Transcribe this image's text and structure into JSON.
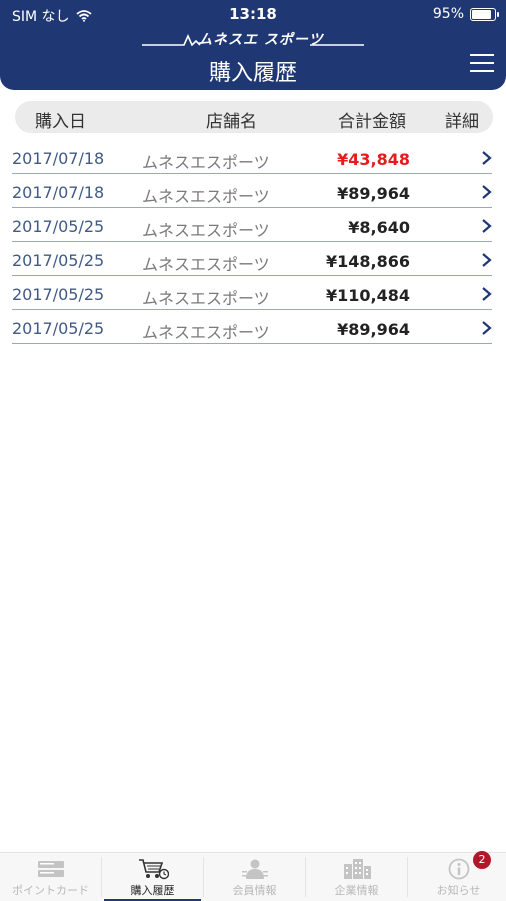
{
  "status_bar": {
    "carrier": "SIM なし",
    "time": "13:18",
    "battery": "95%",
    "battery_level": 0.95
  },
  "header": {
    "logo_text": "ムネスエ スポーツ",
    "title": "購入履歴"
  },
  "table": {
    "columns": [
      "購入日",
      "店舗名",
      "合計金額",
      "詳細"
    ],
    "rows": [
      {
        "date": "2017/07/18",
        "shop": "ムネスエスポーツ",
        "amount": "¥43,848",
        "highlight": true
      },
      {
        "date": "2017/07/18",
        "shop": "ムネスエスポーツ",
        "amount": "¥89,964",
        "highlight": false
      },
      {
        "date": "2017/05/25",
        "shop": "ムネスエスポーツ",
        "amount": "¥8,640",
        "highlight": false
      },
      {
        "date": "2017/05/25",
        "shop": "ムネスエスポーツ",
        "amount": "¥148,866",
        "highlight": false
      },
      {
        "date": "2017/05/25",
        "shop": "ムネスエスポーツ",
        "amount": "¥110,484",
        "highlight": false
      },
      {
        "date": "2017/05/25",
        "shop": "ムネスエスポーツ",
        "amount": "¥89,964",
        "highlight": false
      }
    ]
  },
  "tabs": [
    {
      "label": "ポイントカード",
      "icon": "card-icon",
      "active": false
    },
    {
      "label": "購入履歴",
      "icon": "cart-icon",
      "active": true
    },
    {
      "label": "会員情報",
      "icon": "member-icon",
      "active": false
    },
    {
      "label": "企業情報",
      "icon": "building-icon",
      "active": false
    },
    {
      "label": "お知らせ",
      "icon": "info-icon",
      "active": false,
      "badge": "2"
    }
  ],
  "colors": {
    "header": "#1f3874",
    "highlight_amount": "#e51c1c",
    "date_text": "#415a84",
    "badge": "#b0182a"
  }
}
